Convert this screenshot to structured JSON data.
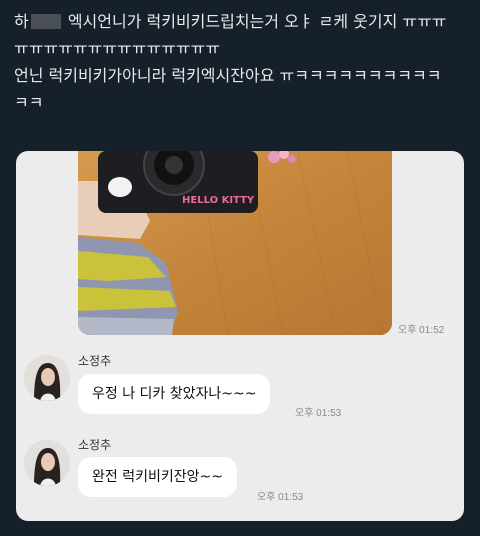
{
  "tweet": {
    "line1_start": "하",
    "line1_rest": " 엑시언니가 럭키비키드립치는거 오ㅑ ㄹ케 웃기지 ㅠㅠㅠ",
    "line2": "ㅠㅠㅠㅠㅠㅠㅠㅠㅠㅠㅠㅠㅠㅠ",
    "line3": "언닌 럭키비키가아니라 럭키엑시잔아요 ㅠㅋㅋㅋㅋㅋㅋㅋㅋㅋㅋ",
    "line4": "ㅋㅋ"
  },
  "chat": {
    "photo_time": "오후 01:52",
    "photo_label": "HELLO KITTY",
    "messages": [
      {
        "sender": "소정추",
        "text": "우정 나 디카 찾았자나~~~",
        "time": "오후 01:53"
      },
      {
        "sender": "소정추",
        "text": "완전 럭키비키잔앙~~",
        "time": "오후 01:53"
      }
    ]
  },
  "colors": {
    "background": "#15202b",
    "chat_background": "#ececec",
    "bubble": "#ffffff"
  }
}
